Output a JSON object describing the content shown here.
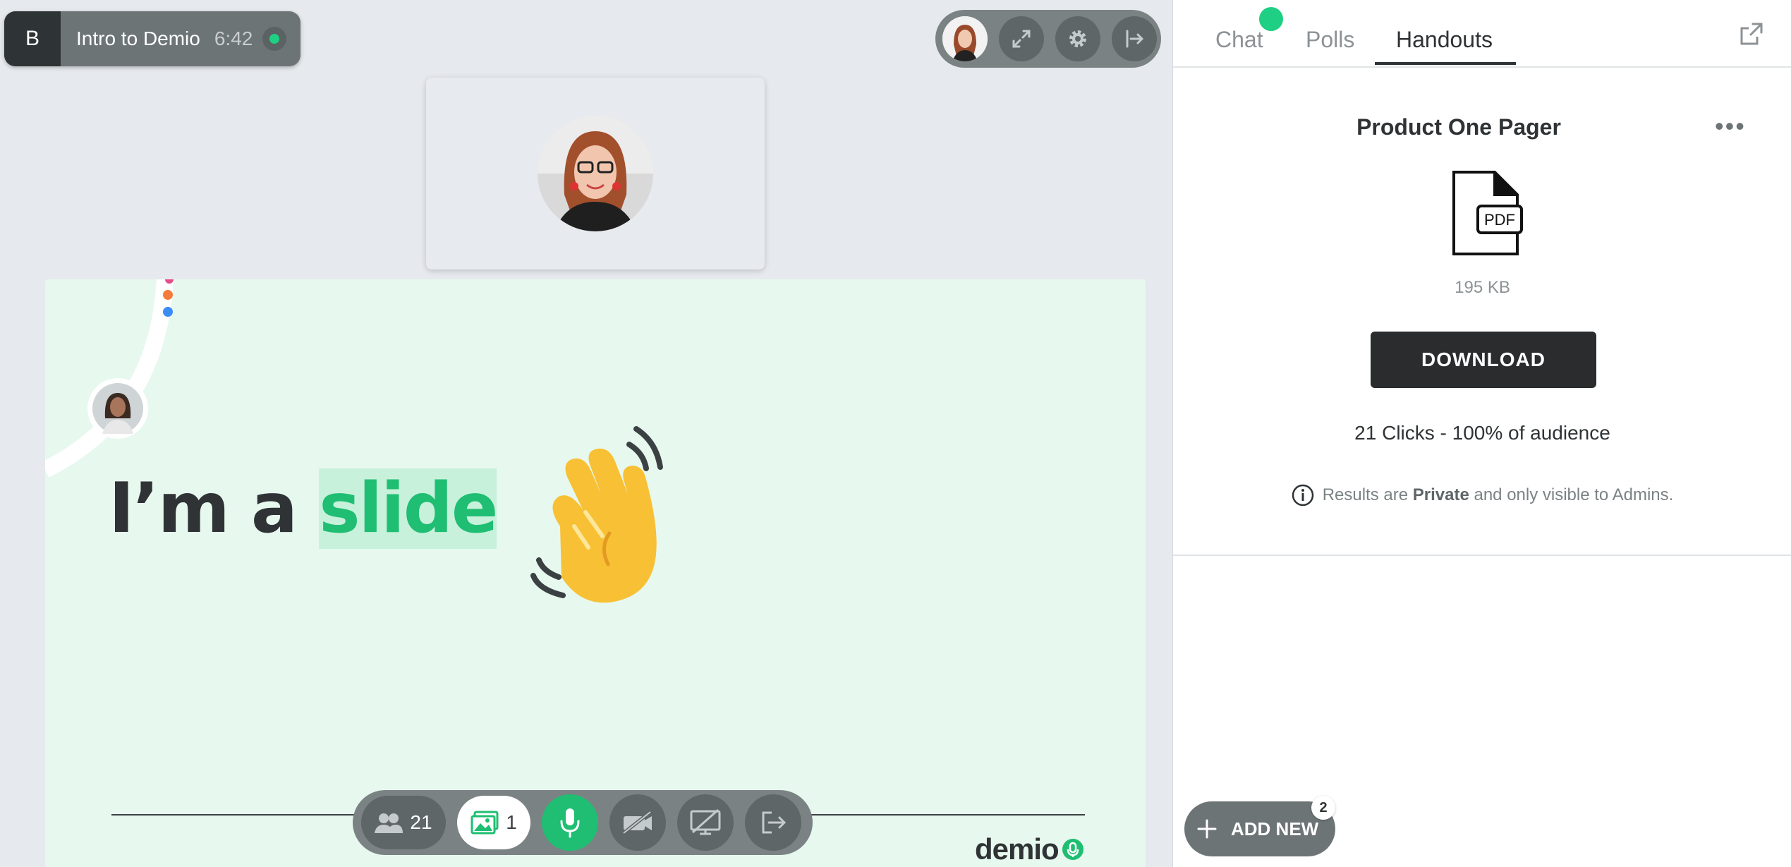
{
  "session": {
    "badge": "B",
    "title": "Intro to Demio",
    "time": "6:42"
  },
  "slide": {
    "text_before": "I’m a ",
    "text_highlight": "slide",
    "brand": "demio"
  },
  "toolbar": {
    "attendees_count": "21",
    "slides_count": "1"
  },
  "panel": {
    "tabs": [
      {
        "label": "Chat"
      },
      {
        "label": "Polls"
      },
      {
        "label": "Handouts"
      }
    ],
    "handout": {
      "title": "Product One Pager",
      "file_type": "PDF",
      "size": "195 KB",
      "download_label": "DOWNLOAD",
      "clicks": "21 Clicks - 100% of audience",
      "privacy_before": "Results are ",
      "privacy_bold": "Private",
      "privacy_after": " and only visible to Admins."
    },
    "add_new_label": "ADD NEW",
    "add_new_badge": "2"
  },
  "colors": {
    "accent_green": "#1fbe72",
    "live_green": "#1fcf83",
    "slide_bg": "#e7f8ef",
    "dark": "#2f3335"
  }
}
